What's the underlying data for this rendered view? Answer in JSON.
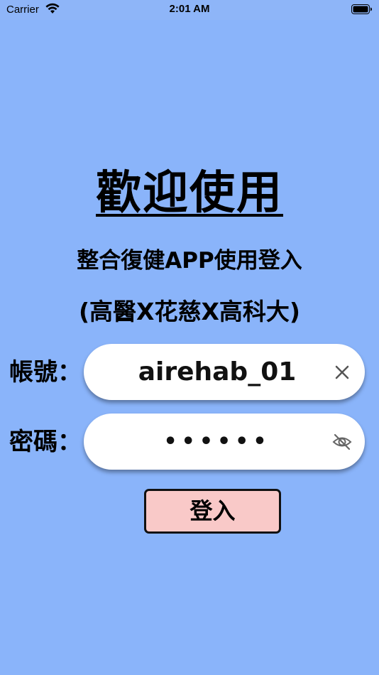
{
  "status_bar": {
    "carrier": "Carrier",
    "time": "2:01 AM"
  },
  "header": {
    "title": "歡迎使用",
    "subtitle": "整合復健APP使用登入",
    "subtitle2": "(高醫X花慈X高科大)"
  },
  "form": {
    "account_label": "帳號：",
    "account_value": "airehab_01",
    "password_label": "密碼：",
    "password_value": "••••••",
    "login_label": "登入"
  },
  "icons": {
    "account_action": "clear-icon",
    "password_action": "eye-slash-icon"
  },
  "colors": {
    "background": "#8ab4fa",
    "field_background": "#ffffff",
    "button_background": "#f9c9c8"
  }
}
